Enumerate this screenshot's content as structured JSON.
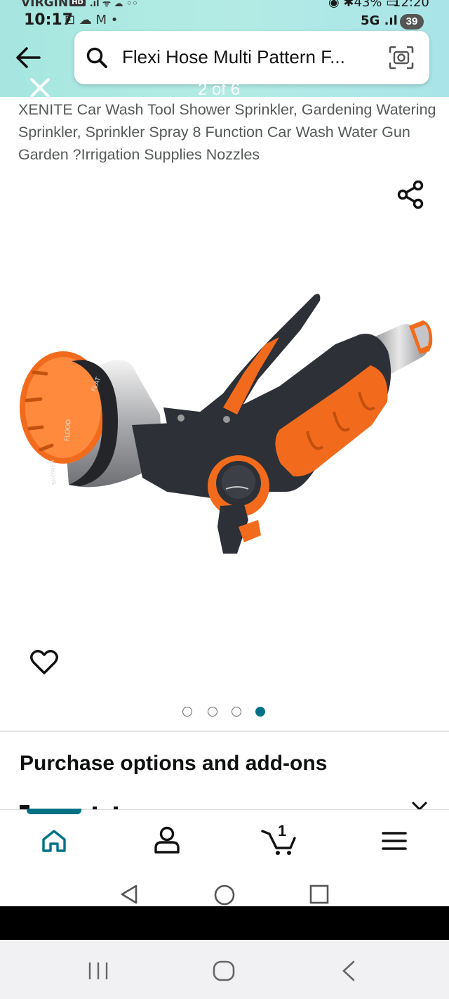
{
  "status_bar": {
    "carrier": "VIRGIN",
    "hd_badge": "HD",
    "time_primary": "10:17",
    "time_secondary": "12:20",
    "battery": "43%",
    "network": "5G",
    "notification_count": "39"
  },
  "search": {
    "query": "Flexi Hose Multi Pattern F..."
  },
  "gallery": {
    "pager": "2 of 6",
    "total_dots": 4,
    "active_dot": 3
  },
  "product": {
    "title": "XENITE Car Wash Tool Shower Sprinkler, Gardening Watering Sprinkler, Sprinkler Spray 8 Function Car Wash Water Gun Garden ?Irrigation Supplies Nozzles",
    "nozzle_labels": [
      "FLAT",
      "FLOOD",
      "SHOWER"
    ]
  },
  "sections": {
    "purchase_options": "Purchase options and add-ons"
  },
  "bottom_nav": {
    "cart_count": "1",
    "items": [
      "home",
      "account",
      "cart",
      "menu"
    ]
  },
  "icons": [
    "back-arrow-icon",
    "search-icon",
    "camera-icon",
    "close-icon",
    "share-icon",
    "heart-icon",
    "home-icon",
    "account-icon",
    "cart-icon",
    "menu-icon",
    "android-back-icon",
    "android-home-icon",
    "android-recents-icon"
  ],
  "colors": {
    "header_bg": "#b0e9e2",
    "accent_teal": "#007185",
    "title_text": "#565959",
    "nozzle_orange": "#f26b1d",
    "nozzle_dark": "#2d3036"
  }
}
